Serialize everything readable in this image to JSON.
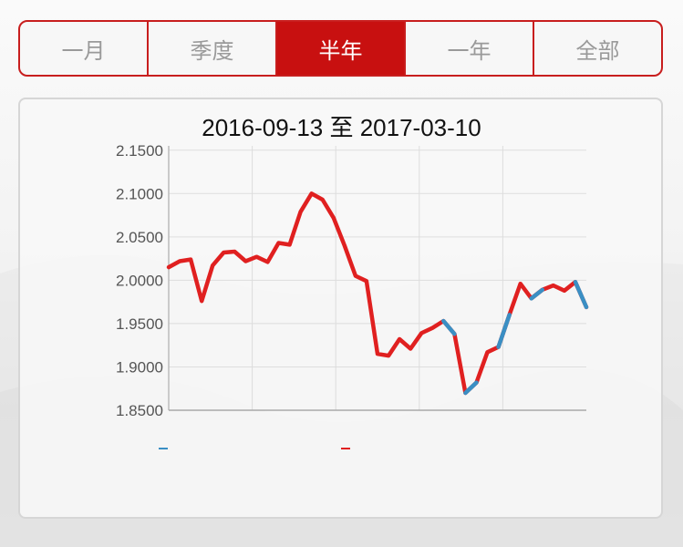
{
  "tabs": [
    {
      "label": "一月",
      "active": false
    },
    {
      "label": "季度",
      "active": false
    },
    {
      "label": "半年",
      "active": true
    },
    {
      "label": "一年",
      "active": false
    },
    {
      "label": "全部",
      "active": false
    }
  ],
  "colors": {
    "accent": "#c81010",
    "line": "#e02020",
    "line_alt": "#3a8fc4",
    "grid": "#dddddd"
  },
  "chart_data": {
    "type": "line",
    "title": "2016-09-13 至 2017-03-10",
    "ylim": [
      1.85,
      2.155
    ],
    "yticks": [
      "2.1500",
      "2.1000",
      "2.0500",
      "2.0000",
      "1.9500",
      "1.9000",
      "1.8500"
    ],
    "ytick_values": [
      2.15,
      2.1,
      2.05,
      2.0,
      1.95,
      1.9,
      1.85
    ],
    "grid": true,
    "series": [
      {
        "values": [
          2.015,
          2.022,
          2.024,
          1.976,
          2.017,
          2.032,
          2.033,
          2.022,
          2.027,
          2.021,
          2.043,
          2.041,
          2.079,
          2.1,
          2.093,
          2.072,
          2.04,
          2.005,
          1.999,
          1.915,
          1.913,
          1.932,
          1.921,
          1.939,
          1.945,
          1.953,
          1.938,
          1.87,
          1.882,
          1.917,
          1.923,
          1.96,
          1.996,
          1.979,
          1.989,
          1.994,
          1.988,
          1.998,
          1.969
        ]
      }
    ],
    "highlight_segments": [
      [
        25,
        26
      ],
      [
        27,
        28
      ],
      [
        30,
        31
      ],
      [
        33,
        34
      ],
      [
        37,
        38
      ]
    ]
  }
}
